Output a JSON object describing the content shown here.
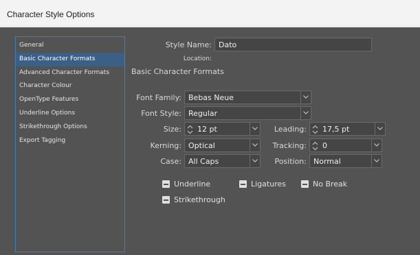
{
  "window": {
    "title": "Character Style Options"
  },
  "sidebar": {
    "items": [
      {
        "label": "General"
      },
      {
        "label": "Basic Character Formats"
      },
      {
        "label": "Advanced Character Formats"
      },
      {
        "label": "Character Colour"
      },
      {
        "label": "OpenType Features"
      },
      {
        "label": "Underline Options"
      },
      {
        "label": "Strikethrough Options"
      },
      {
        "label": "Export Tagging"
      }
    ],
    "active_index": 1
  },
  "form": {
    "style_name_label": "Style Name:",
    "style_name_value": "Dato",
    "location_label": "Location:",
    "section_title": "Basic Character Formats",
    "font_family_label": "Font Family:",
    "font_family_value": "Bebas Neue",
    "font_style_label": "Font Style:",
    "font_style_value": "Regular",
    "size_label": "Size:",
    "size_value": "12 pt",
    "leading_label": "Leading:",
    "leading_value": "17,5 pt",
    "kerning_label": "Kerning:",
    "kerning_value": "Optical",
    "tracking_label": "Tracking:",
    "tracking_value": "0",
    "case_label": "Case:",
    "case_value": "All Caps",
    "position_label": "Position:",
    "position_value": "Normal"
  },
  "checkboxes": {
    "underline": "Underline",
    "ligatures": "Ligatures",
    "no_break": "No Break",
    "strikethrough": "Strikethrough"
  },
  "colors": {
    "panel_bg": "#535353",
    "field_bg": "#454545",
    "selection": "#3c5f86",
    "focus_border": "#3d7fbf"
  }
}
